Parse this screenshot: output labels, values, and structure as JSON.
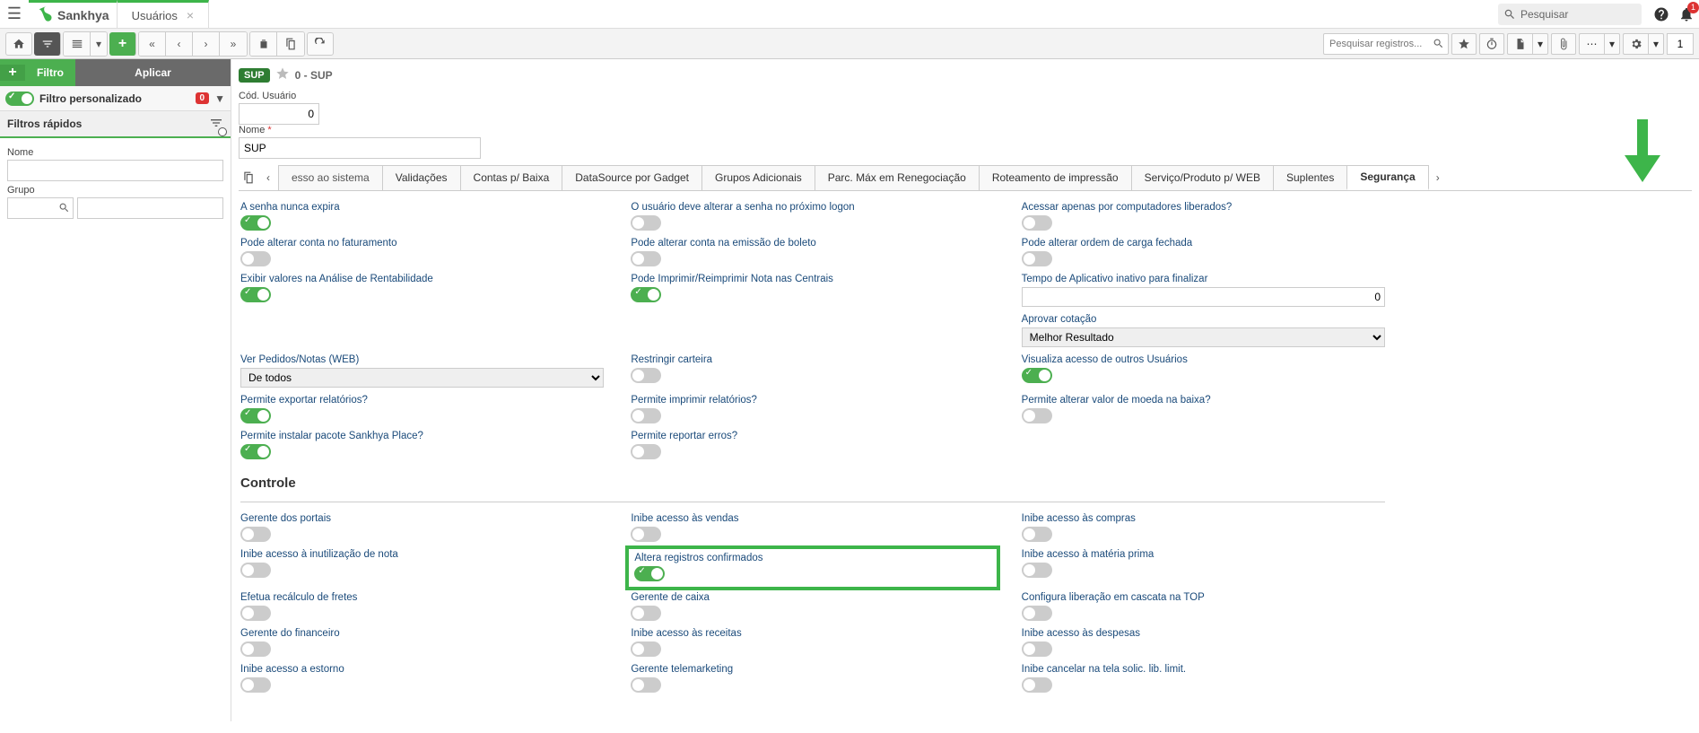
{
  "header": {
    "brand": "Sankhya",
    "tab_title": "Usuários",
    "search_placeholder": "Pesquisar",
    "notif_count": "1"
  },
  "toolbar": {
    "record_search_placeholder": "Pesquisar registros...",
    "page_number": "1"
  },
  "sidebar": {
    "filter_btn": "Filtro",
    "apply_btn": "Aplicar",
    "custom_filter_label": "Filtro personalizado",
    "custom_filter_badge": "0",
    "quick_filters_title": "Filtros rápidos",
    "field_nome_label": "Nome",
    "field_grupo_label": "Grupo"
  },
  "record": {
    "chip": "SUP",
    "title": "0 - SUP",
    "cod_label": "Cód. Usuário",
    "cod_value": "0",
    "nome_label": "Nome",
    "nome_value": "SUP"
  },
  "tabs": {
    "partial_first": "esso ao sistema",
    "t1": "Validações",
    "t2": "Contas p/ Baixa",
    "t3": "DataSource por Gadget",
    "t4": "Grupos Adicionais",
    "t5": "Parc. Máx em Renegociação",
    "t6": "Roteamento de impressão",
    "t7": "Serviço/Produto p/ WEB",
    "t8": "Suplentes",
    "active": "Segurança"
  },
  "settings": {
    "c1r1": "A senha nunca expira",
    "c2r1": "O usuário deve alterar a senha no próximo logon",
    "c3r1": "Acessar apenas por computadores liberados?",
    "c1r2": "Pode alterar conta no faturamento",
    "c2r2": "Pode alterar conta na emissão de boleto",
    "c3r2": "Pode alterar ordem de carga fechada",
    "c1r3": "Exibir valores na Análise de Rentabilidade",
    "c2r3": "Pode Imprimir/Reimprimir Nota nas Centrais",
    "c3r3": "Tempo de Aplicativo inativo para finalizar",
    "c3r3_val": "0",
    "c3r4": "Aprovar cotação",
    "c3r4_val": "Melhor Resultado",
    "c1r5": "Ver Pedidos/Notas (WEB)",
    "c1r5_val": "De todos",
    "c2r5": "Restringir carteira",
    "c3r5": "Visualiza acesso de outros Usuários",
    "c1r6": "Permite exportar relatórios?",
    "c2r6": "Permite imprimir relatórios?",
    "c3r6": "Permite alterar valor de moeda na baixa?",
    "c1r7": "Permite instalar pacote Sankhya Place?",
    "c2r7": "Permite reportar erros?",
    "controle_title": "Controle",
    "ctl_c1r1": "Gerente dos portais",
    "ctl_c2r1": "Inibe acesso às vendas",
    "ctl_c3r1": "Inibe acesso às compras",
    "ctl_c1r2": "Inibe acesso à inutilização de nota",
    "ctl_c2r2": "Altera registros confirmados",
    "ctl_c3r2": "Inibe acesso à matéria prima",
    "ctl_c1r3": "Efetua recálculo de fretes",
    "ctl_c2r3": "Gerente de caixa",
    "ctl_c3r3": "Configura liberação em cascata na TOP",
    "ctl_c1r4": "Gerente do financeiro",
    "ctl_c2r4": "Inibe acesso às receitas",
    "ctl_c3r4": "Inibe acesso às despesas",
    "ctl_c1r5": "Inibe acesso a estorno",
    "ctl_c2r5": "Gerente telemarketing",
    "ctl_c3r5": "Inibe cancelar na tela solic. lib. limit."
  }
}
